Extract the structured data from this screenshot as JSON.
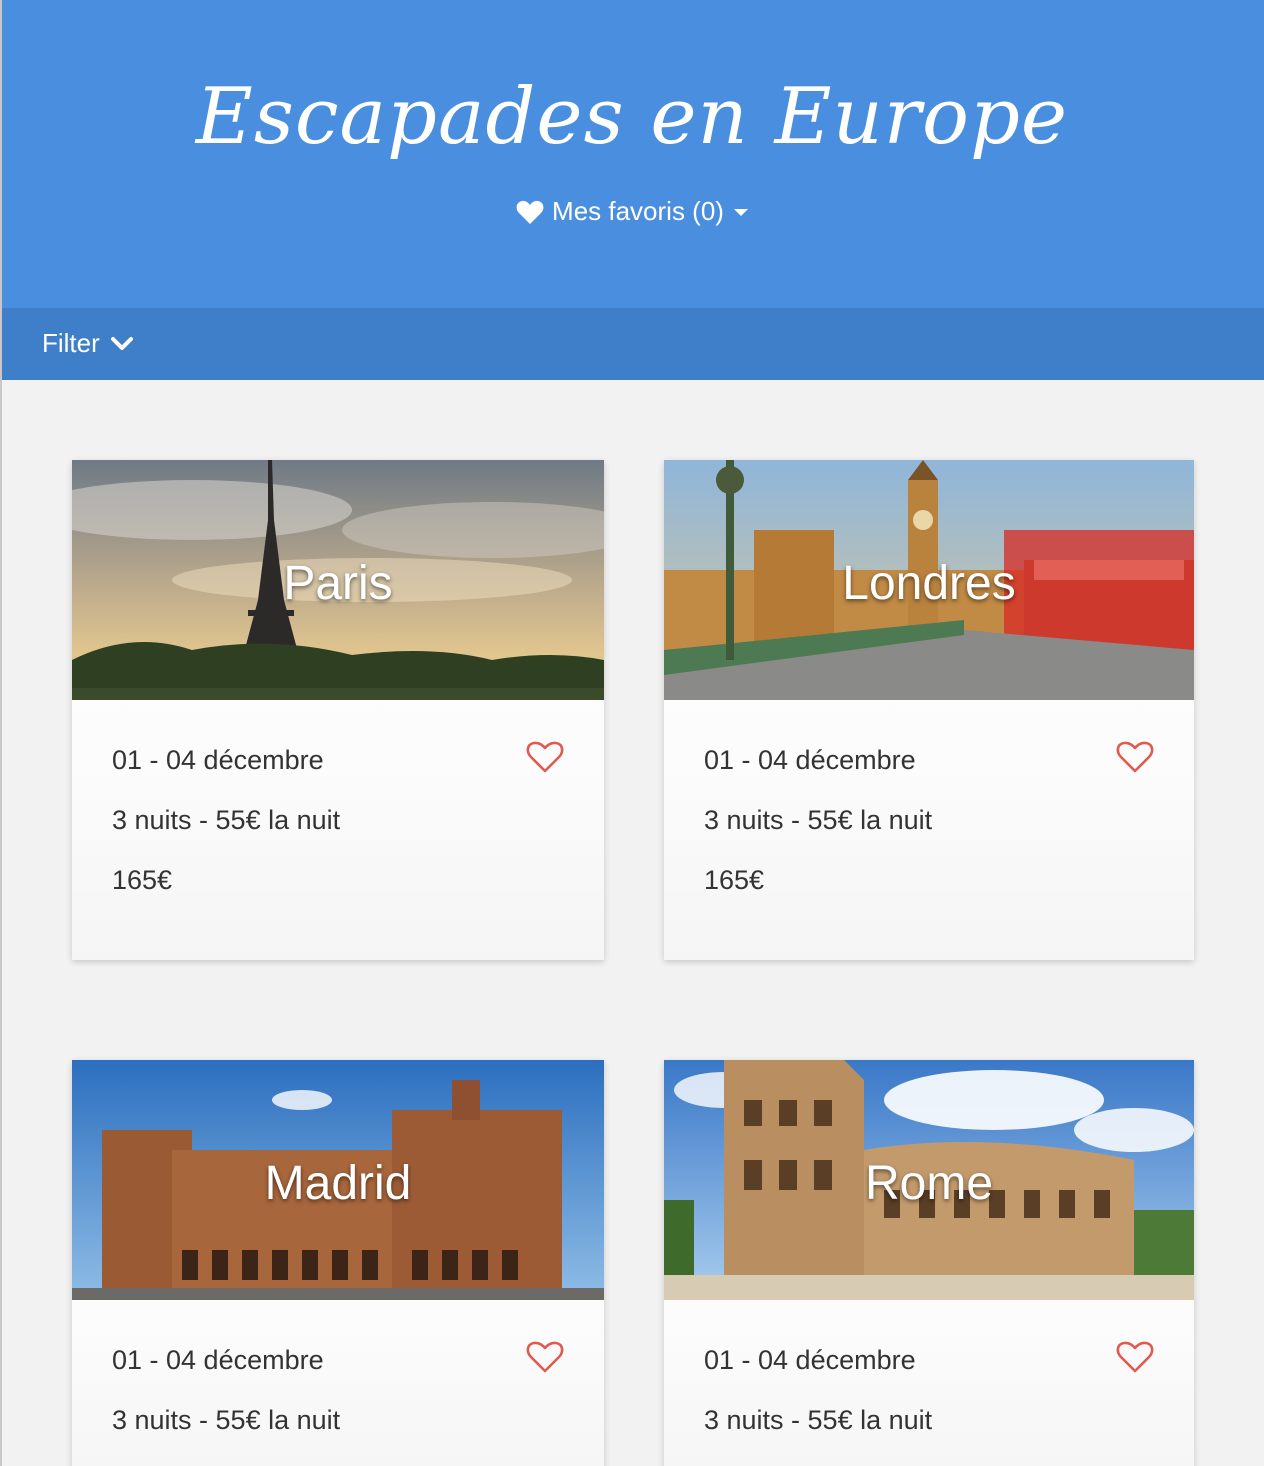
{
  "header": {
    "title": "Escapades en Europe",
    "favorites_label": "Mes favoris (0)"
  },
  "filterbar": {
    "filter_label": "Filter"
  },
  "colors": {
    "header_bg": "#4a8fdf",
    "filterbar_bg": "#3f7fc9",
    "heart_outline": "#e05a4f",
    "page_bg": "#f2f2f2"
  },
  "cards": [
    {
      "city": "Paris",
      "dates": "01 - 04 décembre",
      "nights": "3 nuits - 55€ la nuit",
      "price": "165€"
    },
    {
      "city": "Londres",
      "dates": "01 - 04 décembre",
      "nights": "3 nuits - 55€ la nuit",
      "price": "165€"
    },
    {
      "city": "Madrid",
      "dates": "01 - 04 décembre",
      "nights": "3 nuits - 55€ la nuit",
      "price": ""
    },
    {
      "city": "Rome",
      "dates": "01 - 04 décembre",
      "nights": "3 nuits - 55€ la nuit",
      "price": ""
    }
  ]
}
